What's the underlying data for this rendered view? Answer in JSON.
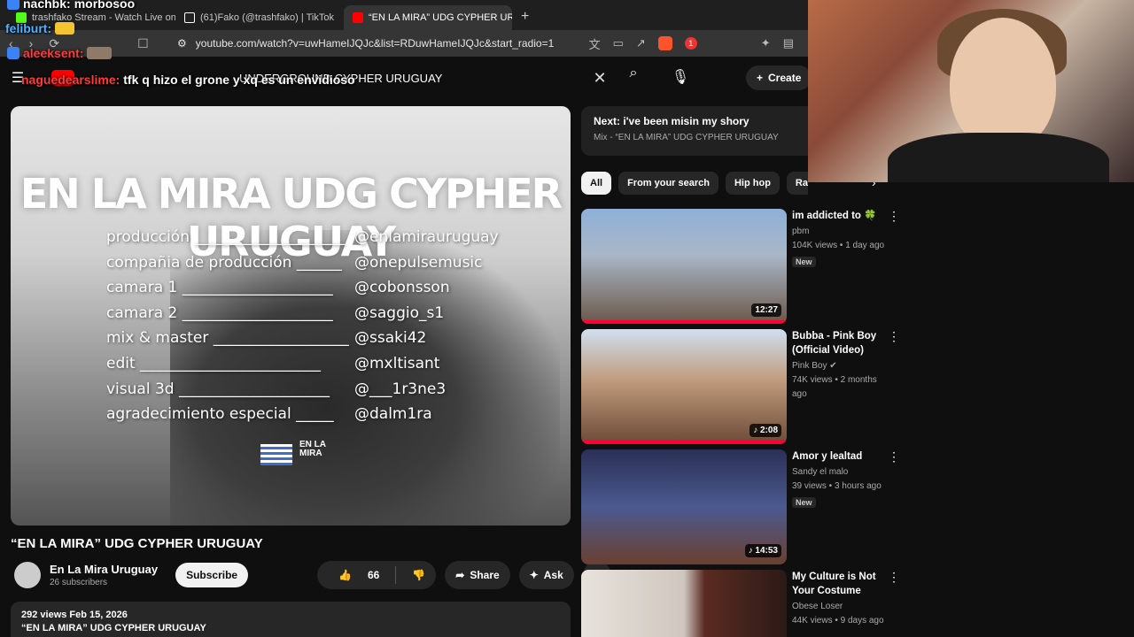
{
  "browser": {
    "tabs": [
      {
        "label": "trashfako Stream - Watch Live on Kick",
        "active": false,
        "favicon_color": "#53fc18"
      },
      {
        "label": "(61)Fako (@trashfako) | TikTok",
        "active": false,
        "favicon_color": "#ffffff"
      },
      {
        "label": "“EN LA MIRA” UDG CYPHER URUGUAY",
        "active": true,
        "favicon_color": "#ff0000"
      }
    ],
    "url": "youtube.com/watch?v=uwHameIJQJc&list=RDuwHameIJQJc&start_radio=1",
    "notification_count": "1"
  },
  "chat": [
    {
      "user": "nachbk:",
      "message": "morbosoo",
      "user_color": "#ffffff"
    },
    {
      "user": "feliburt:",
      "message": "",
      "user_color": "#4fb3ff"
    },
    {
      "user": "aleeksent:",
      "message": "",
      "user_color": "#ff3b3b"
    },
    {
      "user": "naguedearslime:",
      "message": "tfk q hizo el grone y xq es un envidioso",
      "user_color": "#ff3b3b"
    }
  ],
  "header": {
    "search_query": "UNDERGROUND CYPHER URUGUAY",
    "create_label": "Create"
  },
  "video": {
    "overlay_title": "EN LA MIRA UDG CYPHER URUGUAY",
    "credits": [
      {
        "role": "producción ____________________",
        "handle": "@enlamirauruguay"
      },
      {
        "role": "compañia de producción ______",
        "handle": "@onepulsemusic"
      },
      {
        "role": "camara 1 ____________________",
        "handle": "@cobonsson"
      },
      {
        "role": "camara 2 ____________________",
        "handle": "@saggio_s1"
      },
      {
        "role": "mix & master __________________",
        "handle": "@ssaki42"
      },
      {
        "role": "edit ________________________",
        "handle": "@mxltisant"
      },
      {
        "role": "visual 3d ____________________",
        "handle": "@___1r3ne3"
      },
      {
        "role": "agradecimiento especial _____",
        "handle": "@dalm1ra"
      }
    ],
    "logo_text": "EN LA MIRA",
    "title": "“EN LA MIRA” UDG CYPHER URUGUAY",
    "channel": "En La Mira Uruguay",
    "subscribers": "26 subscribers",
    "subscribe_label": "Subscribe",
    "likes": "66",
    "share_label": "Share",
    "ask_label": "Ask",
    "views_date": "292 views  Feb 15, 2026",
    "desc_line": "“EN LA MIRA” UDG CYPHER URUGUAY"
  },
  "sidebar": {
    "next_title": "Next: i've been misin my shory",
    "next_sub": "Mix - “EN LA MIRA” UDG CYPHER URUGUAY",
    "chips": [
      "All",
      "From your search",
      "Hip hop",
      "Rapping",
      "R"
    ],
    "recs": [
      {
        "title": "im addicted to 🍀",
        "channel": "pbm",
        "meta": "104K views • 1 day ago",
        "badge": "New",
        "duration": "12:27",
        "thumb_color": "#6d86a8"
      },
      {
        "title": "Bubba - Pink Boy (Official Video)",
        "channel": "Pink Boy ✔",
        "meta": "74K views • 2 months ago",
        "badge": "",
        "duration": "2:08",
        "thumb_color": "#b58a6a"
      },
      {
        "title": "Amor y lealtad",
        "channel": "Sandy el malo",
        "meta": "39 views • 3 hours ago",
        "badge": "New",
        "duration": "14:53",
        "thumb_color": "#4b5a8f"
      },
      {
        "title": "My Culture is Not Your Costume",
        "channel": "Obese Loser",
        "meta": "44K views • 9 days ago",
        "badge": "",
        "duration": "",
        "thumb_color": "#d9d0c8"
      }
    ]
  }
}
